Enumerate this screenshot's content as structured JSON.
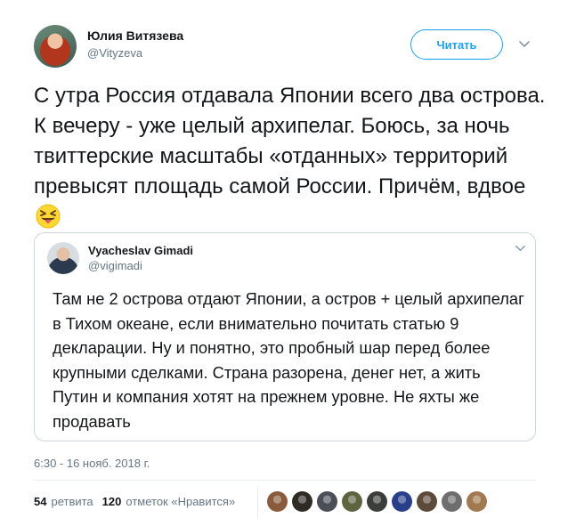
{
  "tweet": {
    "author_name": "Юлия Витязева",
    "author_handle": "@Vityzeva",
    "follow_label": "Читать",
    "text": "С утра Россия отдавала Японии всего два острова. К вечеру - уже целый архипелаг. Боюсь, за ночь твиттерские масштабы «отданных» территорий превысят площадь самой России. Причём, вдвое",
    "emoji_icon": "squinting-face-with-tongue-icon",
    "timestamp": "6:30 - 16 нояб. 2018 г."
  },
  "quoted": {
    "author_name": "Vyacheslav Gimadi",
    "author_handle": "@vigimadi",
    "text": "Там не 2 острова отдают Японии, а остров + целый архипелаг в Тихом океане, если внимательно почитать статью 9 декларации. Ну и понятно, это пробный шар перед более крупными сделками. Страна разорена, денег нет, а жить Путин и компания хотят на прежнем уровне. Не яхты же продавать"
  },
  "stats": {
    "retweets_count": "54",
    "retweets_label": "ретвита",
    "likes_count": "120",
    "likes_label": "отметок «Нравится»"
  },
  "likers": [
    {
      "color": "#8a5a3c"
    },
    {
      "color": "#2e2a24"
    },
    {
      "color": "#4a4e57"
    },
    {
      "color": "#5e6440"
    },
    {
      "color": "#3a3f3a"
    },
    {
      "color": "#2a3f8a"
    },
    {
      "color": "#5c4a3a"
    },
    {
      "color": "#6e6e6e"
    },
    {
      "color": "#a27850"
    }
  ],
  "colors": {
    "accent": "#1da1f2",
    "secondary_text": "#657786",
    "border": "#ccd6dd"
  }
}
